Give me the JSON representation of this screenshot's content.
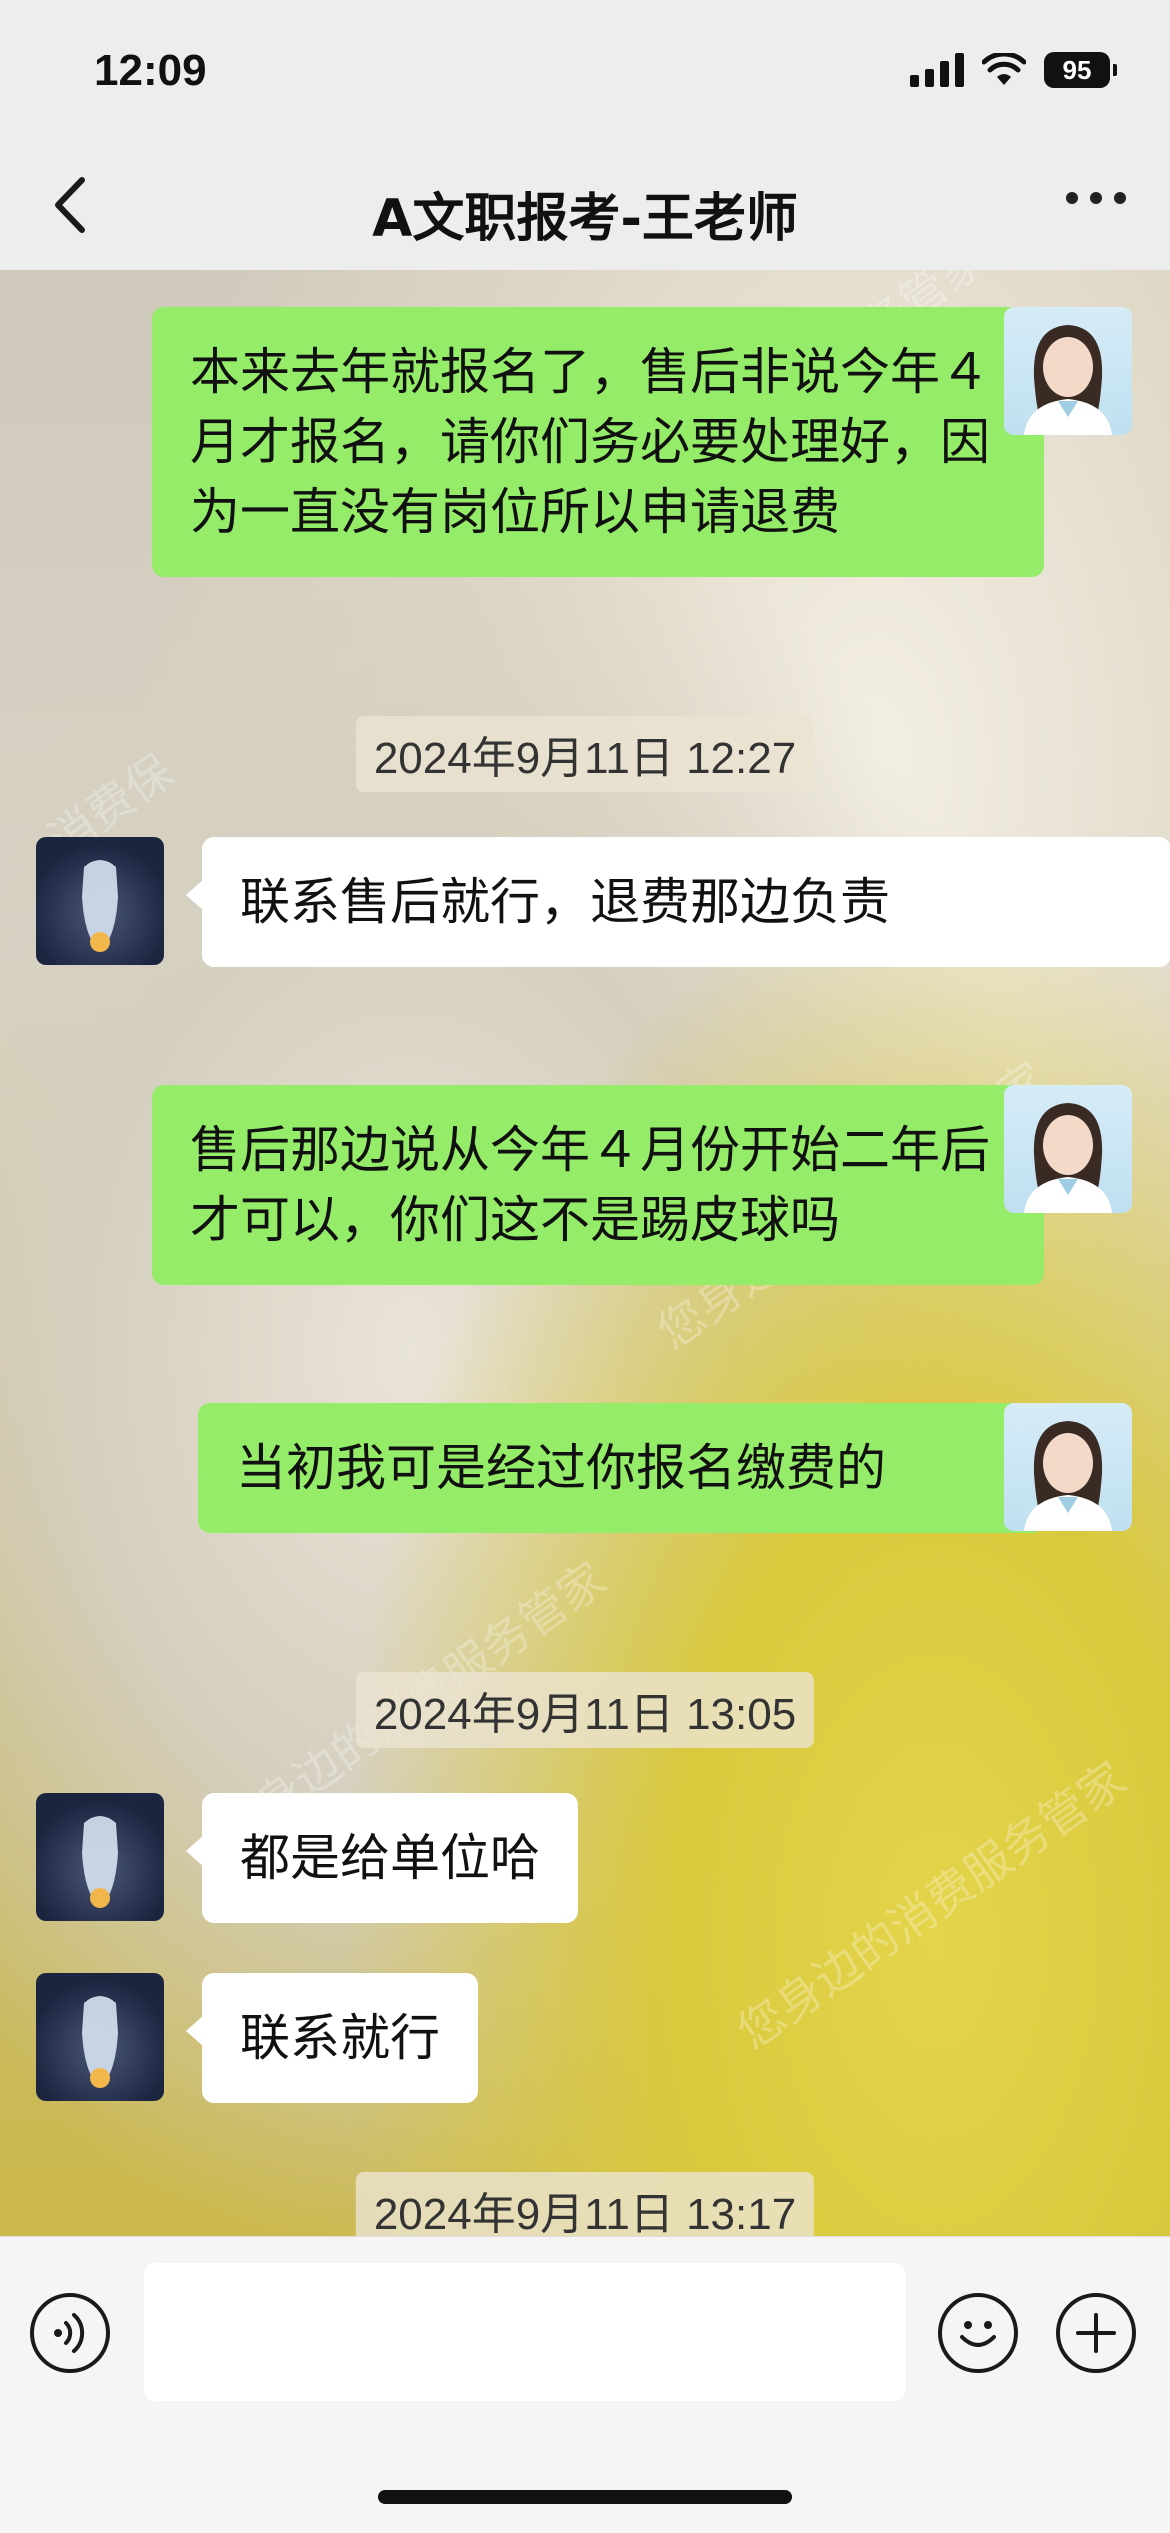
{
  "status_bar": {
    "time": "12:09",
    "battery": "95"
  },
  "nav": {
    "title": "A文职报考-王老师",
    "back_icon": "chevron-left-icon",
    "more_icon": "more-dots-icon"
  },
  "messages": [
    {
      "from": "me",
      "text": "本来去年就报名了，售后非说今年４月才报名，请你们务必要处理好，因为一直没有岗位所以申请退费"
    },
    {
      "timestamp": "2024年9月11日 12:27"
    },
    {
      "from": "them",
      "text": "联系售后就行，退费那边负责"
    },
    {
      "from": "me",
      "text": "售后那边说从今年４月份开始二年后才可以，你们这不是踢皮球吗"
    },
    {
      "from": "me",
      "text": "当初我可是经过你报名缴费的"
    },
    {
      "timestamp": "2024年9月11日 13:05"
    },
    {
      "from": "them",
      "text": "都是给单位哈"
    },
    {
      "from": "them",
      "text": "联系就行"
    },
    {
      "timestamp": "2024年9月11日 13:17"
    }
  ],
  "watermark": [
    "消费保",
    "您身边的消费服务管家"
  ],
  "input": {
    "value": "",
    "voice_icon": "voice-icon",
    "emoji_icon": "emoji-icon",
    "plus_icon": "plus-icon"
  }
}
